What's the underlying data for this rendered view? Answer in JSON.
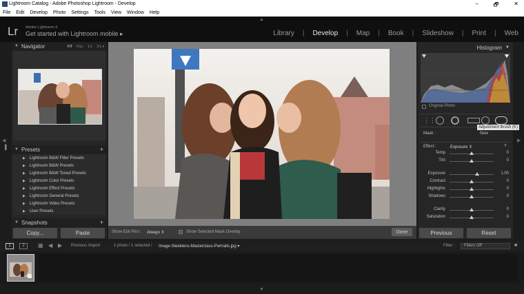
{
  "window": {
    "title": "Lightroom Catalog - Adobe Photoshop Lightroom - Develop",
    "min": "–",
    "max": "🗗",
    "close": "✕"
  },
  "menu": [
    "File",
    "Edit",
    "Develop",
    "Photo",
    "Settings",
    "Tools",
    "View",
    "Window",
    "Help"
  ],
  "identity": {
    "logo": "Lr",
    "product": "Adobe Lightroom 6",
    "tagline": "Get started with Lightroom mobile ▸"
  },
  "modules": [
    "Library",
    "Develop",
    "Map",
    "Book",
    "Slideshow",
    "Print",
    "Web"
  ],
  "navigator": {
    "title": "Navigator",
    "opts": [
      "FIT",
      "FILL",
      "1:1",
      "3:1 ▾"
    ]
  },
  "presets": {
    "title": "Presets",
    "add": "+",
    "items": [
      "Lightroom B&W Filter Presets",
      "Lightroom B&W Presets",
      "Lightroom B&W Toned Presets",
      "Lightroom Color Presets",
      "Lightroom Effect Presets",
      "Lightroom General Presets",
      "Lightroom Video Presets",
      "User Presets"
    ]
  },
  "snapshots": {
    "title": "Snapshots",
    "add": "+"
  },
  "left_buttons": {
    "copy": "Copy...",
    "paste": "Paste"
  },
  "toolbar": {
    "show_edit_pins": "Show Edit Pins :",
    "pins_value": "Always ⇕",
    "show_mask": "Show Selected Mask Overlay",
    "done": "Done"
  },
  "right": {
    "histogram": "Histogram",
    "original_photo": "Original Photo",
    "mask_label": "Mask :",
    "mask_value": "New",
    "tooltip": "Adjustment Brush (K)",
    "effect_label": "Effect :",
    "effect_value": "Exposure ⇕",
    "sliders": [
      {
        "name": "Temp",
        "val": "0",
        "pos": 0.5
      },
      {
        "name": "Tint",
        "val": "0",
        "pos": 0.5
      },
      {
        "name": "Exposure",
        "val": "1.00",
        "pos": 0.63
      },
      {
        "name": "Contrast",
        "val": "0",
        "pos": 0.5
      },
      {
        "name": "Highlights",
        "val": "0",
        "pos": 0.5
      },
      {
        "name": "Shadows",
        "val": "0",
        "pos": 0.5
      },
      {
        "name": "Clarity",
        "val": "0",
        "pos": 0.5
      },
      {
        "name": "Saturation",
        "val": "0",
        "pos": 0.5
      }
    ],
    "previous": "Previous",
    "reset": "Reset"
  },
  "filmbar": {
    "page1": "1",
    "page2": "2",
    "previous_import": "Previous Import",
    "count": "1 photo / 1 selected /",
    "filename": "Image-Sleeklens-Masterclass-Portraits.jpg ▾",
    "filter_label": "Filter :",
    "filter_value": "Filters Off"
  },
  "colors": {
    "accent": "#e8e8e8",
    "panel": "#262626",
    "bg": "#1c1c1c"
  }
}
